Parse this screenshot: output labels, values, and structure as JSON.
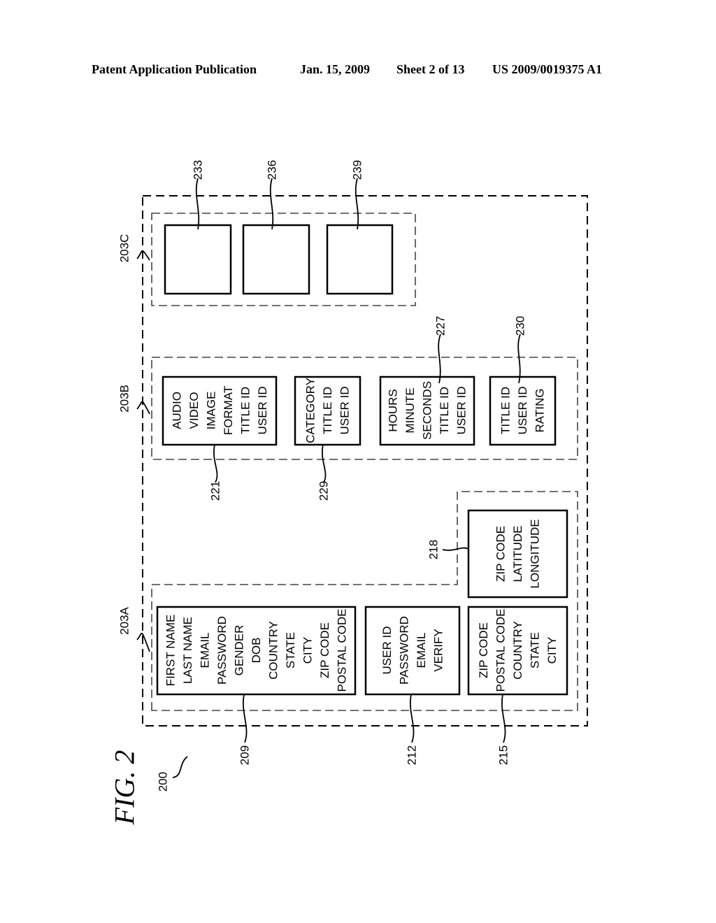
{
  "header": {
    "left": "Patent Application Publication",
    "center": "Jan. 15, 2009",
    "sheet": "Sheet 2 of 13",
    "right": "US 2009/0019375 A1"
  },
  "figure": {
    "label": "FIG. 2",
    "ref": "200"
  },
  "groups": {
    "a": "203A",
    "b": "203B",
    "c": "203C"
  },
  "boxes": {
    "b209": {
      "ref": "209",
      "lines": [
        "FIRST NAME",
        "LAST NAME",
        "EMAIL",
        "PASSWORD",
        "GENDER",
        "DOB",
        "COUNTRY",
        "STATE",
        "CITY",
        "ZIP CODE",
        "POSTAL CODE"
      ]
    },
    "b212": {
      "ref": "212",
      "lines": [
        "USER ID",
        "PASSWORD",
        "EMAIL",
        "VERIFY"
      ]
    },
    "b215": {
      "ref": "215",
      "lines": [
        "ZIP CODE",
        "POSTAL CODE",
        "COUNTRY",
        "STATE",
        "CITY"
      ]
    },
    "b218": {
      "ref": "218",
      "lines": [
        "ZIP CODE",
        "LATITUDE",
        "LONGITUDE"
      ]
    },
    "b221": {
      "ref": "221",
      "lines": [
        "AUDIO",
        "VIDEO",
        "IMAGE",
        "FORMAT",
        "TITLE ID",
        "USER ID"
      ]
    },
    "b229": {
      "ref": "229",
      "lines": [
        "CATEGORY",
        "TITLE ID",
        "USER ID"
      ]
    },
    "b227": {
      "ref": "227",
      "lines": [
        "HOURS",
        "MINUTE",
        "SECONDS",
        "TITLE ID",
        "USER ID"
      ]
    },
    "b230": {
      "ref": "230",
      "lines": [
        "TITLE ID",
        "USER ID",
        "RATING"
      ]
    },
    "b233": {
      "ref": "233",
      "lines": []
    },
    "b236": {
      "ref": "236",
      "lines": []
    },
    "b239": {
      "ref": "239",
      "lines": []
    }
  }
}
